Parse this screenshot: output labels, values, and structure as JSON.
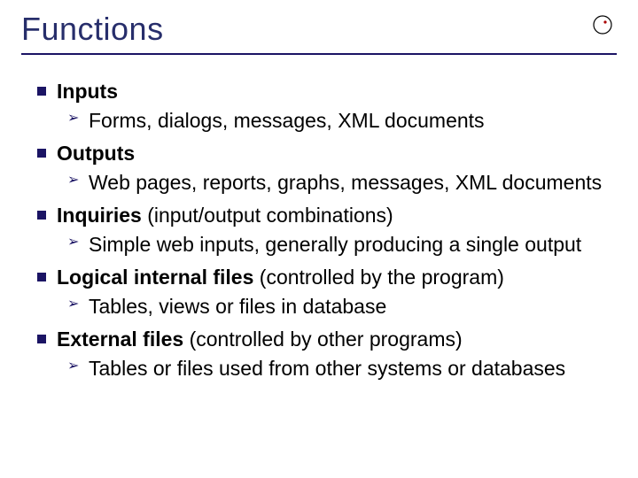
{
  "title": "Functions",
  "logo_name": "circle-dot-logo",
  "items": [
    {
      "heading": "Inputs",
      "paren": "",
      "sub": "Forms, dialogs, messages, XML documents"
    },
    {
      "heading": "Outputs",
      "paren": "",
      "sub": "Web pages, reports, graphs, messages, XML documents"
    },
    {
      "heading": "Inquiries",
      "paren": " (input/output combinations)",
      "sub": "Simple web inputs, generally producing a single output"
    },
    {
      "heading": "Logical internal files",
      "paren": " (controlled by the program)",
      "sub": "Tables, views or files in database"
    },
    {
      "heading": "External files",
      "paren": " (controlled by other programs)",
      "sub": "Tables or files used from other systems or databases"
    }
  ]
}
